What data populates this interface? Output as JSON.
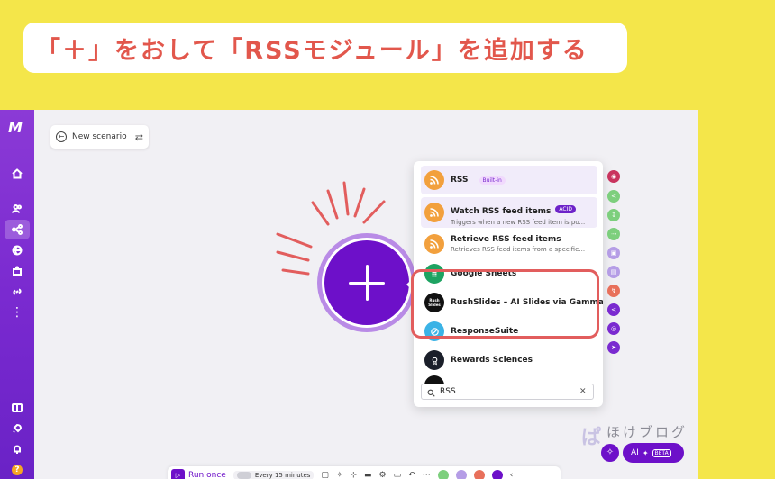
{
  "banner": {
    "text": "「＋」をおして「RSSモジュール」を追加する"
  },
  "scenario": {
    "label": "New scenario"
  },
  "sidebar": {
    "logo": "M",
    "help": "?"
  },
  "dropdown": {
    "items": [
      {
        "title": "RSS",
        "tag": "Built-in",
        "subtitle": ""
      },
      {
        "title": "Watch RSS feed items",
        "tag": "ACID",
        "subtitle": "Triggers when a new RSS feed item is po..."
      },
      {
        "title": "Retrieve RSS feed items",
        "tag": "",
        "subtitle": "Retrieves RSS feed items from a specifie..."
      },
      {
        "title": "Google Sheets",
        "tag": "",
        "subtitle": ""
      },
      {
        "title": "RushSlides – AI Slides via Gamma...",
        "tag": "",
        "subtitle": ""
      },
      {
        "title": "ResponseSuite",
        "tag": "",
        "subtitle": ""
      },
      {
        "title": "Rewards Sciences",
        "tag": "",
        "subtitle": ""
      }
    ],
    "rushslides_icon_text": "Rush Slides",
    "search": {
      "value": "RSS",
      "clear": "✕"
    }
  },
  "toolbar": {
    "run_label": "Run once",
    "schedule_label": "Every 15 minutes"
  },
  "ai": {
    "label": "AI",
    "beta": "BETA"
  },
  "watermark": {
    "text": "ほけブログ"
  },
  "colors": {
    "accent": "#6d10c9",
    "highlight": "#e25d5d",
    "rss": "#f2a03d",
    "banner_text": "#e2574c"
  }
}
